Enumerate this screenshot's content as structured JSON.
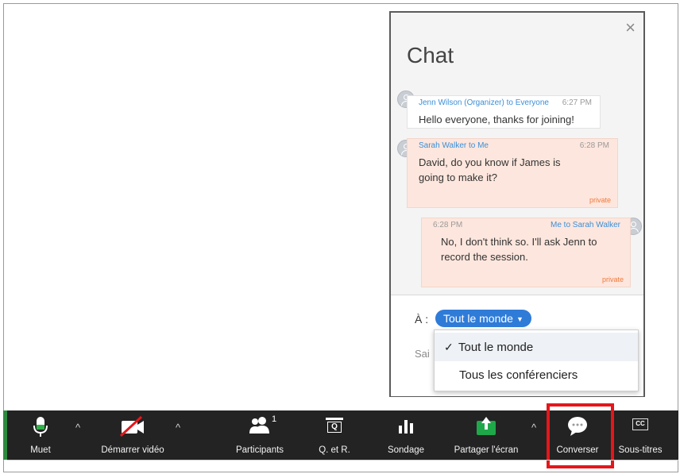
{
  "chat": {
    "title": "Chat",
    "close": "×",
    "messages": [
      {
        "sender": "Jenn Wilson (Organizer) to Everyone",
        "time": "6:27 PM",
        "text": "Hello everyone, thanks for joining!"
      },
      {
        "sender": "Sarah Walker to Me",
        "time": "6:28 PM",
        "text": "David, do you know if James is going to make it?",
        "tag": "private"
      },
      {
        "sender": "Me to Sarah Walker",
        "time": "6:28 PM",
        "text": "No, I don't think so. I'll ask Jenn to record the session.",
        "tag": "private"
      }
    ],
    "to_label": "À :",
    "to_value": "Tout le monde",
    "caret": "▼",
    "input_placeholder": "Sai",
    "dropdown": {
      "check": "✓",
      "options": [
        "Tout le monde",
        "Tous les conférenciers"
      ],
      "selected": "Tout le monde"
    }
  },
  "toolbar": {
    "mute": "Muet",
    "video": "Démarrer vidéo",
    "participants": "Participants",
    "participants_count": "1",
    "qa": "Q. et R.",
    "qa_icon_text": "Q",
    "poll": "Sondage",
    "share": "Partager l'écran",
    "chat": "Converser",
    "chat_icon_text": "···",
    "captions": "Sous-titres",
    "captions_icon_text": "CC",
    "chevron": "^"
  },
  "colors": {
    "accent_blue": "#2f7bd8",
    "private_bubble": "#fde6dd",
    "toolbar_bg": "#232323",
    "highlight_red": "#e5161b",
    "share_green": "#1fa84a"
  }
}
